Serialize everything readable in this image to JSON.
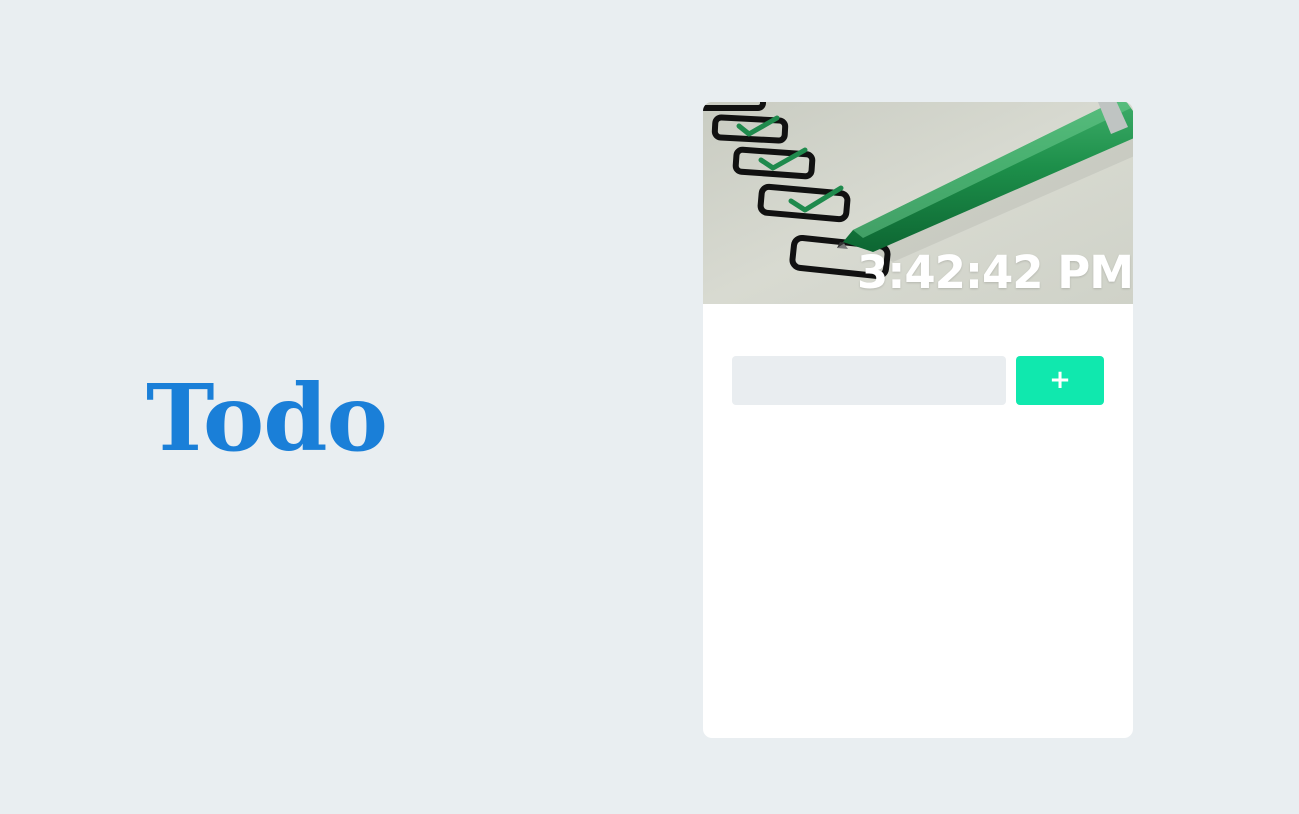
{
  "app": {
    "title": "Todo"
  },
  "card": {
    "clock": "3:42:42 PM",
    "input": {
      "value": "",
      "placeholder": ""
    },
    "add_button_label": "+",
    "tasks": []
  },
  "colors": {
    "background": "#e9eef1",
    "title": "#1a7fd8",
    "accent": "#10e8ae",
    "card": "#ffffff",
    "input_bg": "#e9edf0"
  },
  "icons": {
    "hero_image": "checklist-with-pen-icon"
  }
}
